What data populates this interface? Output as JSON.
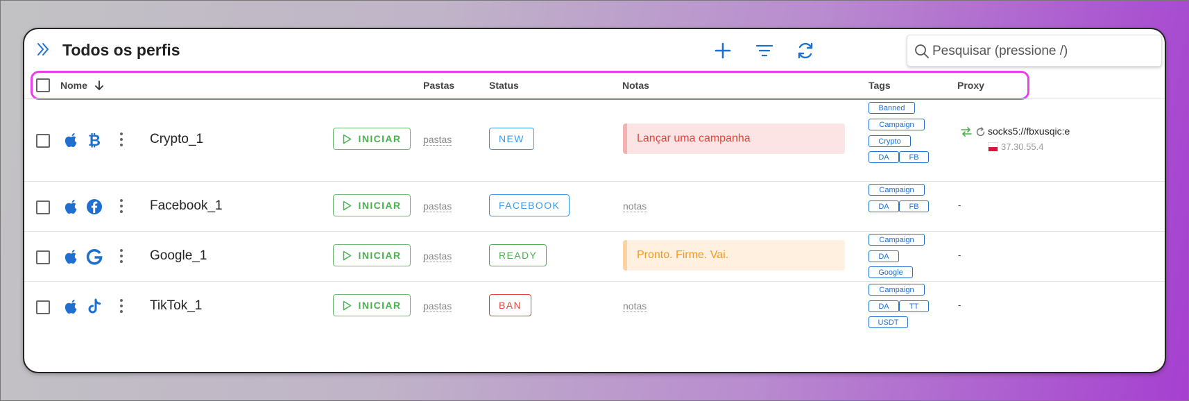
{
  "header": {
    "title": "Todos os perfis",
    "search_placeholder": "Pesquisar (pressione /)",
    "icons": [
      "chevron-double-right-icon",
      "plus-icon",
      "filter-icon",
      "refresh-icon",
      "search-icon"
    ]
  },
  "columns": {
    "name": "Nome",
    "folders": "Pastas",
    "status": "Status",
    "notes": "Notas",
    "tags": "Tags",
    "proxy": "Proxy"
  },
  "colors": {
    "accent": "#1e6fd0",
    "start_green": "#4caf50",
    "highlight": "#ea40e8"
  },
  "profiles": [
    {
      "name": "Crypto_1",
      "os_icon": "apple-icon",
      "brand_icon": "bitcoin-icon",
      "start_label": "INICIAR",
      "folders": "pastas",
      "status": "NEW",
      "note": "Lançar uma campanha",
      "tags": [
        "Banned",
        "Campaign",
        "Crypto",
        "DA",
        "FB"
      ],
      "proxy": "socks5://fbxusqic:e",
      "proxy_ip": "37.30.55.4"
    },
    {
      "name": "Facebook_1",
      "os_icon": "apple-icon",
      "brand_icon": "facebook-icon",
      "start_label": "INICIAR",
      "folders": "pastas",
      "status": "FACEBOOK",
      "note": "notas",
      "tags": [
        "Campaign",
        "DA",
        "FB"
      ],
      "proxy": "-"
    },
    {
      "name": "Google_1",
      "os_icon": "apple-icon",
      "brand_icon": "google-icon",
      "start_label": "INICIAR",
      "folders": "pastas",
      "status": "READY",
      "note": "Pronto. Firme. Vai.",
      "tags": [
        "Campaign",
        "DA",
        "Google"
      ],
      "proxy": "-"
    },
    {
      "name": "TikTok_1",
      "os_icon": "apple-icon",
      "brand_icon": "tiktok-icon",
      "start_label": "INICIAR",
      "folders": "pastas",
      "status": "BAN",
      "note": "notas",
      "tags": [
        "Campaign",
        "DA",
        "TT",
        "USDT"
      ],
      "proxy": "-"
    }
  ]
}
